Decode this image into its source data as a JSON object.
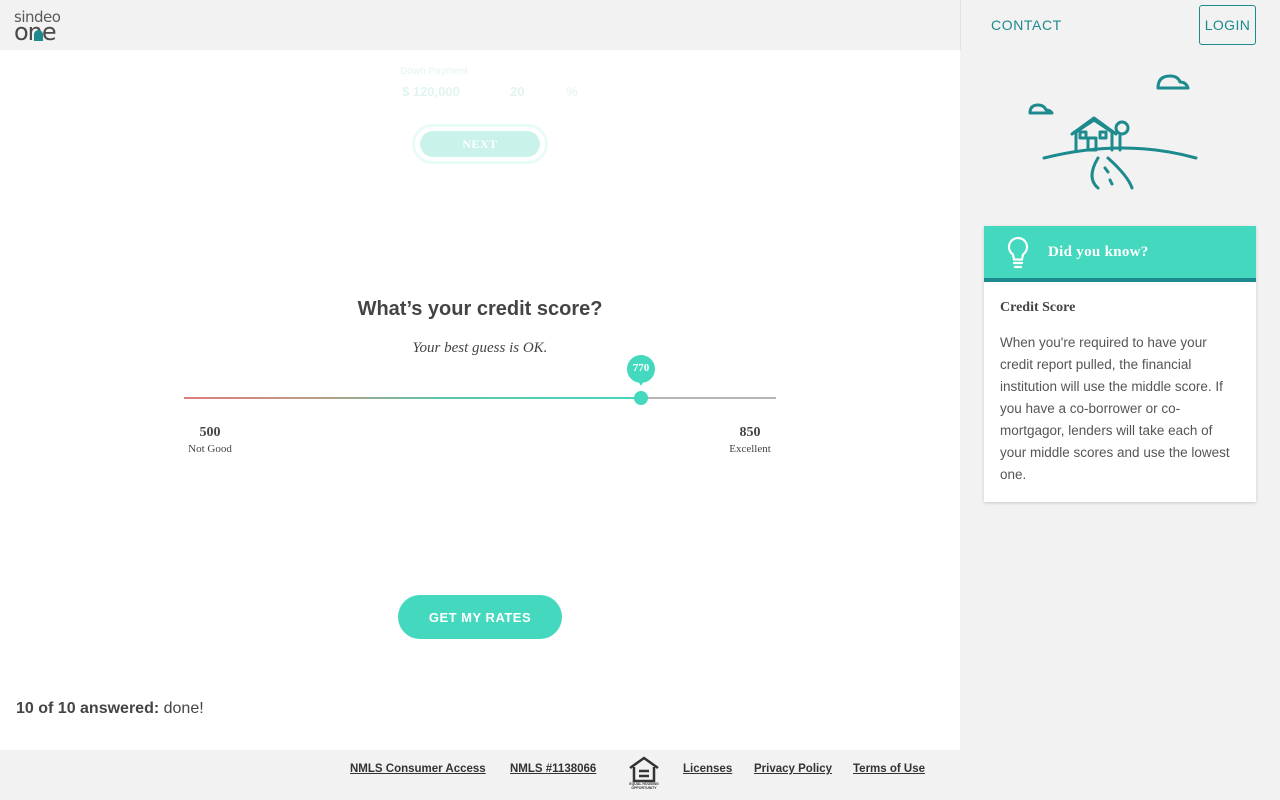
{
  "header": {
    "logo_top": "sindeo",
    "logo_bottom": "one",
    "contact_label": "CONTACT",
    "login_label": "LOGIN"
  },
  "ghost": {
    "field_label": "Down Payment",
    "amount": "$ 120,000",
    "percent": "20",
    "percent_sign": "%",
    "next_label": "NEXT"
  },
  "question": {
    "title": "What’s your credit score?",
    "hint": "Your best guess is OK."
  },
  "slider": {
    "min": 500,
    "max": 850,
    "value": 770,
    "value_label": "770",
    "min_label": "500",
    "min_desc": "Not Good",
    "max_label": "850",
    "max_desc": "Excellent"
  },
  "cta": {
    "rates_label": "GET MY RATES"
  },
  "progress": {
    "count": "10 of 10 answered:",
    "status": "done!"
  },
  "sidebar": {
    "tip_title": "Did you know?",
    "tip_subtitle": "Credit Score",
    "tip_body": "When you're required to have your credit report pulled, the financial institution will use the middle score. If you have a co-borrower or co-mortgagor, lenders will take each of your middle scores and use the lowest one."
  },
  "footer": {
    "links": [
      "NMLS Consumer Access",
      "NMLS #1138066",
      "Licenses",
      "Privacy Policy",
      "Terms of Use"
    ],
    "eho_text": "EQUAL HOUSING OPPORTUNITY"
  },
  "colors": {
    "accent": "#44d8be",
    "brand": "#1d8a8e",
    "panel": "#f2f2f2"
  },
  "icons": {
    "logo": "sindeo-one-logo",
    "bulb": "lightbulb-icon",
    "eho": "equal-housing-icon",
    "illustration": "house-on-hill-illustration"
  }
}
